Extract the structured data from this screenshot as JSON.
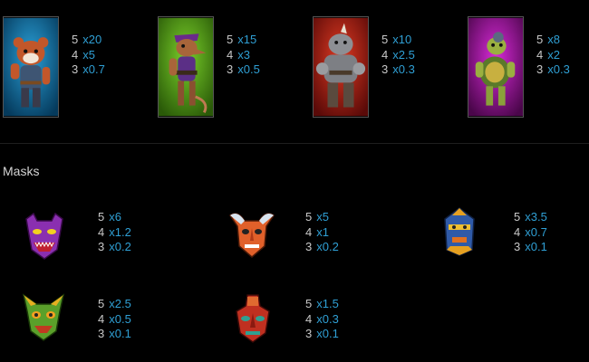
{
  "characters": [
    {
      "icon": "red-panda-character-icon",
      "bg": "#0e6a9a",
      "pays": [
        {
          "count": "5",
          "mult": "x20"
        },
        {
          "count": "4",
          "mult": "x5"
        },
        {
          "count": "3",
          "mult": "x0.7"
        }
      ]
    },
    {
      "icon": "rat-character-icon",
      "bg": "#4f9a16",
      "pays": [
        {
          "count": "5",
          "mult": "x15"
        },
        {
          "count": "4",
          "mult": "x3"
        },
        {
          "count": "3",
          "mult": "x0.5"
        }
      ]
    },
    {
      "icon": "rhino-character-icon",
      "bg": "#b01e14",
      "pays": [
        {
          "count": "5",
          "mult": "x10"
        },
        {
          "count": "4",
          "mult": "x2.5"
        },
        {
          "count": "3",
          "mult": "x0.3"
        }
      ]
    },
    {
      "icon": "turtle-character-icon",
      "bg": "#a417a8",
      "pays": [
        {
          "count": "5",
          "mult": "x8"
        },
        {
          "count": "4",
          "mult": "x2"
        },
        {
          "count": "3",
          "mult": "x0.3"
        }
      ]
    }
  ],
  "masks_section": {
    "title": "Masks",
    "items": [
      {
        "icon": "purple-dragon-mask-icon",
        "pays": [
          {
            "count": "5",
            "mult": "x6"
          },
          {
            "count": "4",
            "mult": "x1.2"
          },
          {
            "count": "3",
            "mult": "x0.2"
          }
        ]
      },
      {
        "icon": "horned-orange-mask-icon",
        "pays": [
          {
            "count": "5",
            "mult": "x5"
          },
          {
            "count": "4",
            "mult": "x1"
          },
          {
            "count": "3",
            "mult": "x0.2"
          }
        ]
      },
      {
        "icon": "blue-diamond-mask-icon",
        "pays": [
          {
            "count": "5",
            "mult": "x3.5"
          },
          {
            "count": "4",
            "mult": "x0.7"
          },
          {
            "count": "3",
            "mult": "x0.1"
          }
        ]
      },
      {
        "icon": "green-horned-mask-icon",
        "pays": [
          {
            "count": "5",
            "mult": "x2.5"
          },
          {
            "count": "4",
            "mult": "x0.5"
          },
          {
            "count": "3",
            "mult": "x0.1"
          }
        ]
      },
      {
        "icon": "red-long-mask-icon",
        "pays": [
          {
            "count": "5",
            "mult": "x1.5"
          },
          {
            "count": "4",
            "mult": "x0.3"
          },
          {
            "count": "3",
            "mult": "x0.1"
          }
        ]
      }
    ]
  },
  "colors": {
    "multiplier": "#2f9fd4",
    "count": "#c8c8c8",
    "title": "#d4d4d4"
  }
}
